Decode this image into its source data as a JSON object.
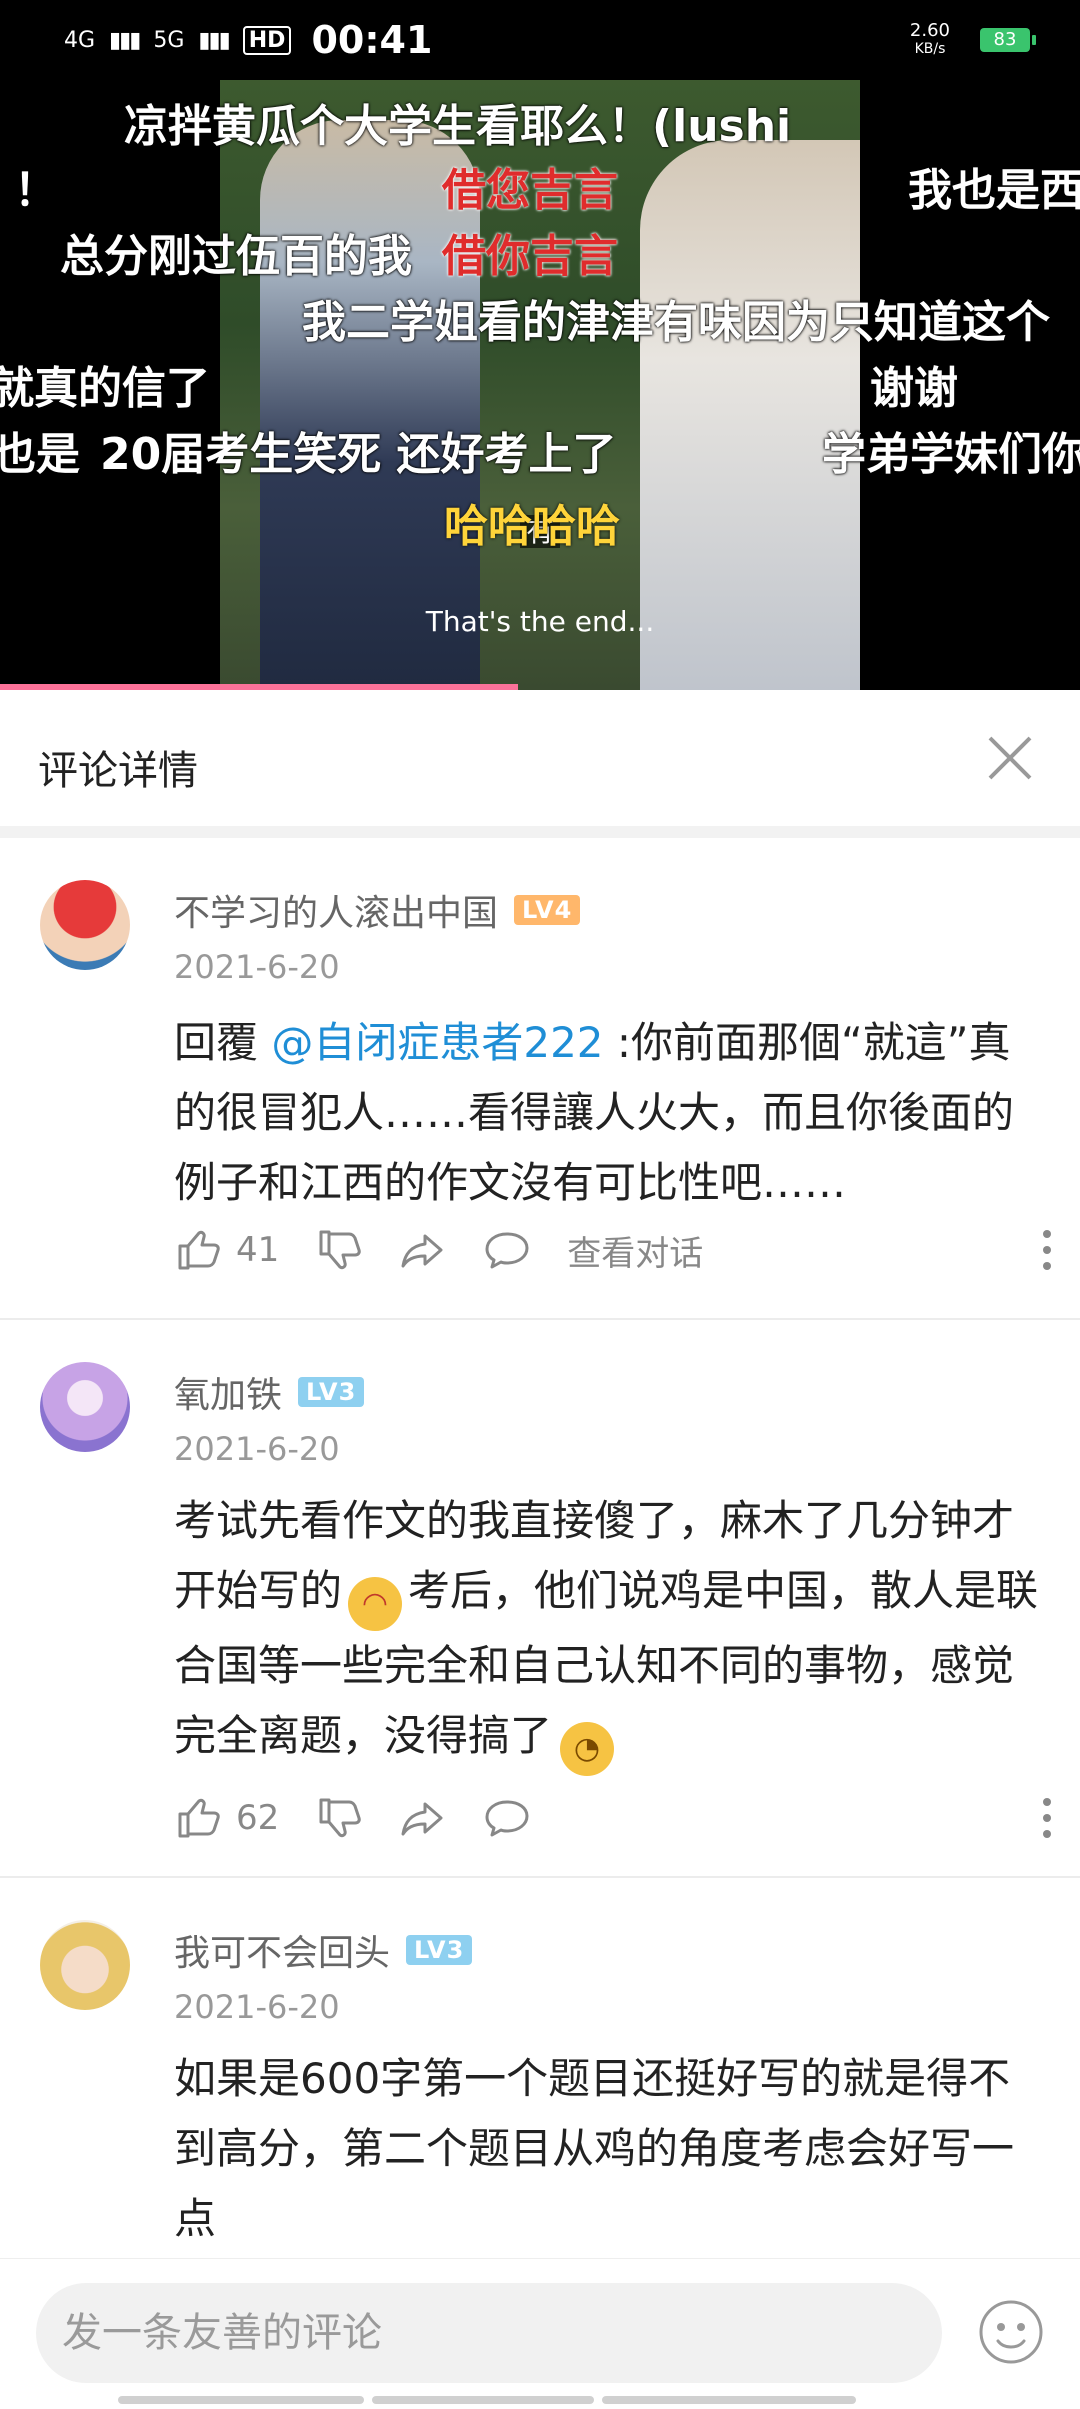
{
  "status_bar": {
    "network_1": "4G",
    "network_2": "5G",
    "hd": "HD",
    "time": "00:41",
    "speed": "2.60",
    "speed_unit": "KB/s",
    "battery": "83"
  },
  "video": {
    "subtitle_1": "有",
    "subtitle_2": "That's the end...",
    "danmaku": [
      {
        "text": "凉拌黄瓜个大学生看耶么！(lushi",
        "color": "white"
      },
      {
        "text": "借您吉言",
        "color": "red"
      },
      {
        "text": "！",
        "color": "white"
      },
      {
        "text": "我也是西",
        "color": "white"
      },
      {
        "text": "总分刚过伍百的我",
        "color": "white"
      },
      {
        "text": "借你吉言",
        "color": "red"
      },
      {
        "text": "我二学姐看的津津有味因为只知道这个",
        "color": "white"
      },
      {
        "text": "就真的信了",
        "color": "white"
      },
      {
        "text": "谢谢",
        "color": "white"
      },
      {
        "text": "也是",
        "color": "white"
      },
      {
        "text": "20届考生笑死  还好考上了",
        "color": "white"
      },
      {
        "text": "学弟学妹们你",
        "color": "white"
      },
      {
        "text": "哈哈哈哈",
        "color": "yellow"
      }
    ],
    "progress": 0.48
  },
  "header": {
    "title": "评论详情"
  },
  "comments": [
    {
      "user": "不学习的人滚出中国",
      "level": "LV4",
      "date": "2021-6-20",
      "reply_prefix": "回覆 ",
      "mention": "@自闭症患者222",
      "text": " :你前面那個“就這”真的很冒犯人……看得讓人火大，而且你後面的例子和江西的作文沒有可比性吧……",
      "likes": "41",
      "view_dialog": "查看对话"
    },
    {
      "user": "氧加铁",
      "level": "LV3",
      "date": "2021-6-20",
      "text_1": "考试先看作文的我直接傻了，麻木了几分钟才开始写的",
      "text_2": "考后，他们说鸡是中国，散人是联合国等一些完全和自己认知不同的事物，感觉完全离题，没得搞了",
      "likes": "62"
    },
    {
      "user": "我可不会回头",
      "level": "LV3",
      "date": "2021-6-20",
      "text": "如果是600字第一个题目还挺好写的就是得不到高分，第二个题目从鸡的角度考虑会好写一点"
    }
  ],
  "input": {
    "placeholder": "发一条友善的评论"
  },
  "icons": [
    "close-icon",
    "like-icon",
    "dislike-icon",
    "share-icon",
    "reply-icon",
    "more-icon",
    "emoji-icon"
  ]
}
